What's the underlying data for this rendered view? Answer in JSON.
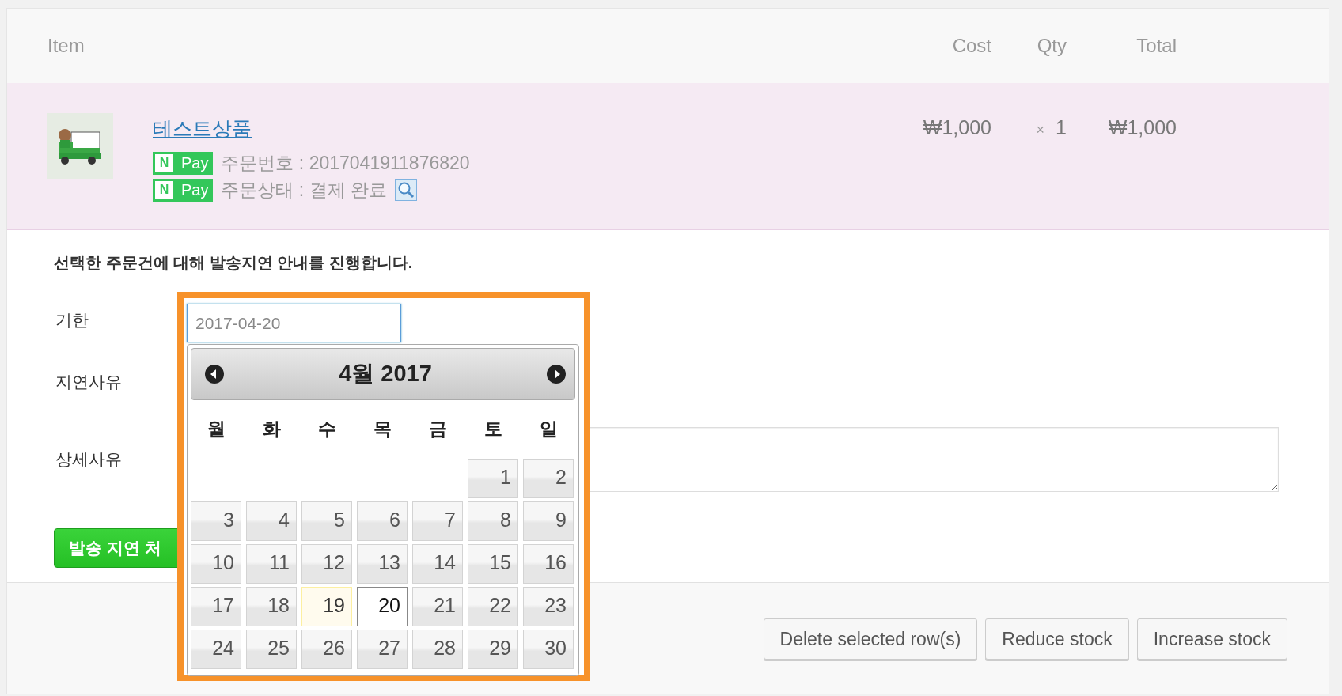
{
  "table": {
    "columns": [
      {
        "label": "Item"
      },
      {
        "label": "Cost"
      },
      {
        "label": "Qty"
      },
      {
        "label": "Total"
      }
    ],
    "rows": [
      {
        "kind": "picture",
        "product": "테스트상품",
        "cost": "₩1,000",
        "qty_sign": "×",
        "qty": "1",
        "total": "₩1,000",
        "meta": [
          {
            "badge_mark": "N",
            "badge": "Pay",
            "text": "주문번호 : 2017041911876820"
          },
          {
            "badge_mark": "N",
            "badge": "Pay",
            "text": "주문상태 : 결제 완료",
            "search_button": true
          }
        ]
      }
    ]
  },
  "form": {
    "intro": "선택한 주문건에 대해 발송지연 안내를 진행합니다.",
    "labels": [
      "기한",
      "지연사유",
      "상세사유"
    ],
    "date_value": "2017-04-20",
    "submit": "발송 지연 처"
  },
  "datepicker": {
    "title": "4월 2017",
    "weekdays": [
      "월",
      "화",
      "수",
      "목",
      "금",
      "토",
      "일"
    ],
    "weeks": [
      [
        {
          "kind": "blank"
        },
        {
          "kind": "blank"
        },
        {
          "kind": "blank"
        },
        {
          "kind": "blank"
        },
        {
          "kind": "blank"
        },
        {
          "kind": "day",
          "label": "1",
          "today": false,
          "selected": false
        },
        {
          "kind": "day",
          "label": "2",
          "today": false,
          "selected": false
        }
      ],
      [
        {
          "kind": "day",
          "label": "3",
          "today": false,
          "selected": false
        },
        {
          "kind": "day",
          "label": "4",
          "today": false,
          "selected": false
        },
        {
          "kind": "day",
          "label": "5",
          "today": false,
          "selected": false
        },
        {
          "kind": "day",
          "label": "6",
          "today": false,
          "selected": false
        },
        {
          "kind": "day",
          "label": "7",
          "today": false,
          "selected": false
        },
        {
          "kind": "day",
          "label": "8",
          "today": false,
          "selected": false
        },
        {
          "kind": "day",
          "label": "9",
          "today": false,
          "selected": false
        }
      ],
      [
        {
          "kind": "day",
          "label": "10",
          "today": false,
          "selected": false
        },
        {
          "kind": "day",
          "label": "11",
          "today": false,
          "selected": false
        },
        {
          "kind": "day",
          "label": "12",
          "today": false,
          "selected": false
        },
        {
          "kind": "day",
          "label": "13",
          "today": false,
          "selected": false
        },
        {
          "kind": "day",
          "label": "14",
          "today": false,
          "selected": false
        },
        {
          "kind": "day",
          "label": "15",
          "today": false,
          "selected": false
        },
        {
          "kind": "day",
          "label": "16",
          "today": false,
          "selected": false
        }
      ],
      [
        {
          "kind": "day",
          "label": "17",
          "today": false,
          "selected": false
        },
        {
          "kind": "day",
          "label": "18",
          "today": false,
          "selected": false
        },
        {
          "kind": "day",
          "label": "19",
          "today": true,
          "selected": false
        },
        {
          "kind": "day",
          "label": "20",
          "today": false,
          "selected": true
        },
        {
          "kind": "day",
          "label": "21",
          "today": false,
          "selected": false
        },
        {
          "kind": "day",
          "label": "22",
          "today": false,
          "selected": false
        },
        {
          "kind": "day",
          "label": "23",
          "today": false,
          "selected": false
        }
      ],
      [
        {
          "kind": "day",
          "label": "24",
          "today": false,
          "selected": false
        },
        {
          "kind": "day",
          "label": "25",
          "today": false,
          "selected": false
        },
        {
          "kind": "day",
          "label": "26",
          "today": false,
          "selected": false
        },
        {
          "kind": "day",
          "label": "27",
          "today": false,
          "selected": false
        },
        {
          "kind": "day",
          "label": "28",
          "today": false,
          "selected": false
        },
        {
          "kind": "day",
          "label": "29",
          "today": false,
          "selected": false
        },
        {
          "kind": "day",
          "label": "30",
          "today": false,
          "selected": false
        }
      ]
    ]
  },
  "actions": [
    "Delete selected row(s)",
    "Reduce stock",
    "Increase stock"
  ]
}
